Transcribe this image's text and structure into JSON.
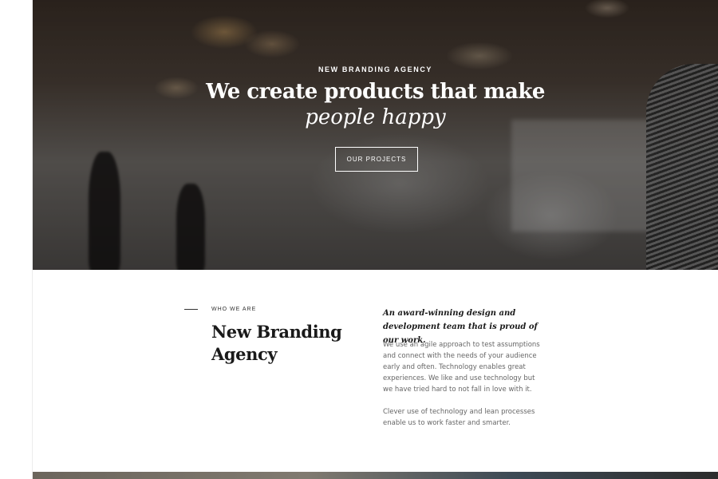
{
  "hero": {
    "eyebrow": "NEW BRANDING AGENCY",
    "title_line1": "We create products that make",
    "title_line2": "people happy",
    "button_label": "OUR PROJECTS"
  },
  "about": {
    "eyebrow": "WHO WE ARE",
    "title": "New Branding Agency",
    "lead": "An award-winning design and development team that is proud of our work.",
    "paragraph1": "We use an agile approach to test assumptions and connect with the needs of your audience early and often. Technology enables great experiences. We like and use technology but we have tried hard to not fall in love with it.",
    "paragraph2": "Clever use of technology and lean processes enable us to work faster and smarter."
  }
}
